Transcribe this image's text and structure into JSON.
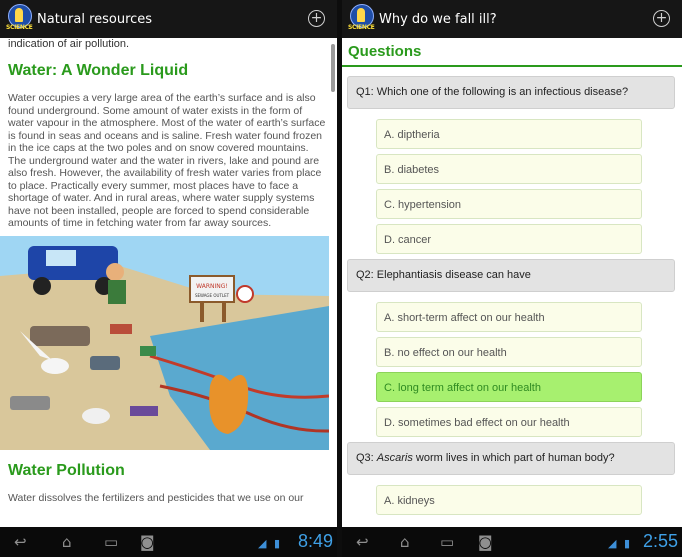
{
  "left": {
    "app_title": "Natural resources",
    "logo_text": "SCIENCE",
    "top_fragment": "indication of air pollution.",
    "section1_heading": "Water: A Wonder Liquid",
    "section1_body": "Water occupies a very large area of the earth’s surface and is also found underground. Some amount of water exists in the form of water vapour in the atmosphere. Most of the water of earth’s surface is found in seas and oceans and is saline. Fresh water found frozen in the ice caps at the two poles and on snow covered mountains. The underground water and the water in rivers, lake and pound are also fresh. However, the availability of fresh water varies from place to place. Practically every summer, most places have to face a shortage of water. And in rural areas, where water supply systems have not been installed, people are forced to spend considerable amounts of time in fetching water from far away sources.",
    "sign_text": "WARNING!",
    "sign_subtext": "SEWAGE OUTLET",
    "section2_heading": "Water Pollution",
    "section2_body": "Water dissolves the fertilizers and pesticides that we use on our",
    "clock": "8:49"
  },
  "right": {
    "app_title": "Why do we fall ill?",
    "logo_text": "SCIENCE",
    "quiz_title": "Questions",
    "questions": [
      {
        "text": "Q1: Which one of the following is an infectious disease?",
        "options": [
          "A. diptheria",
          "B. diabetes",
          "C. hypertension",
          "D. cancer"
        ]
      },
      {
        "text": "Q2: Elephantiasis disease can have",
        "options": [
          "A. short-term affect on our health",
          "B. no effect on our health",
          "C. long term affect on our health",
          "D. sometimes bad effect on our health"
        ],
        "highlighted_option": "C. long term affect on our health"
      },
      {
        "text_prefix": "Q3: ",
        "text_italic": "Ascaris",
        "text_suffix": " worm lives in which part of human body?",
        "options": [
          "A. kidneys"
        ]
      }
    ],
    "clock": "2:55"
  },
  "icons": {
    "add": "plus-circle-icon",
    "back": "back-icon",
    "home": "home-icon",
    "recents": "recent-apps-icon",
    "screenshot": "camera-icon",
    "usb": "usb-icon",
    "signal": "signal-icon"
  },
  "colors": {
    "heading_green": "#2a9a1c",
    "correct_bg": "#a7f06f",
    "option_bg": "#fbfde9",
    "actionbar": "#161616",
    "clock_blue": "#3fa0e6"
  }
}
